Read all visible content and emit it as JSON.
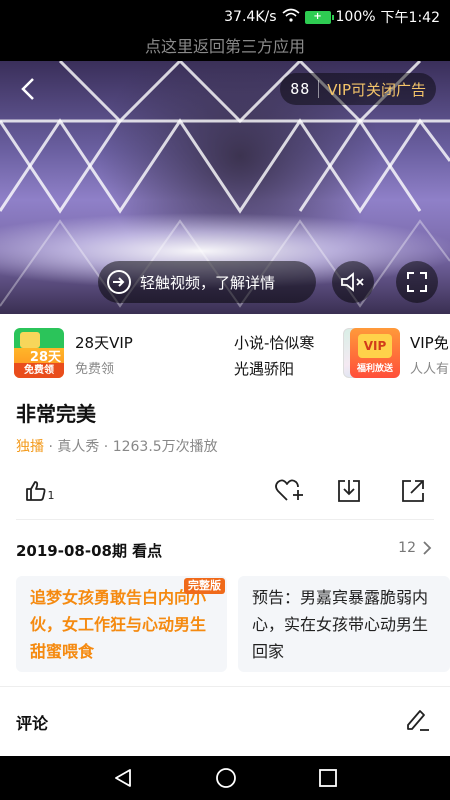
{
  "status": {
    "speed": "37.4K/s",
    "battery_percent": "100%",
    "time": "下午1:42"
  },
  "return_bar": {
    "label": "点这里返回第三方应用"
  },
  "video": {
    "timer": "88",
    "vip_ad_label": "VIP可关闭广告",
    "detail_label": "轻触视频，了解详情"
  },
  "promos": [
    {
      "thumb_badge": "28天",
      "thumb_sub": "免费领",
      "title": "28天VIP",
      "subtitle": "免费领"
    },
    {
      "title": "小说-恰似寒",
      "subtitle": "光遇骄阳"
    },
    {
      "thumb_badge": "VIP",
      "thumb_sub": "福利放送",
      "title": "VIP免",
      "subtitle": "人人有"
    }
  ],
  "show": {
    "title": "非常完美",
    "exclusive": "独播",
    "meta_rest": " · 真人秀 · 1263.5万次播放",
    "like_count": "1"
  },
  "episode": {
    "heading": "2019-08-08期 看点",
    "count": "12",
    "cards": [
      {
        "badge": "完整版",
        "text": "追梦女孩勇敢告白内向小伙，女工作狂与心动男生甜蜜喂食"
      },
      {
        "text": "预告：男嘉宾暴露脆弱内心，实在女孩带心动男生回家"
      }
    ]
  },
  "comments": {
    "heading": "评论"
  },
  "colors": {
    "accent_orange": "#f58a10",
    "vip_gold": "#f5c56a",
    "battery_green": "#2ecc52"
  },
  "icons": [
    "wifi-icon",
    "battery-icon",
    "back-arrow-icon",
    "login-arrow-icon",
    "mute-icon",
    "fullscreen-icon",
    "thumbs-up-icon",
    "favorite-add-icon",
    "download-icon",
    "share-icon",
    "chevron-right-icon",
    "edit-icon",
    "nav-back-icon",
    "nav-home-icon",
    "nav-recents-icon"
  ]
}
